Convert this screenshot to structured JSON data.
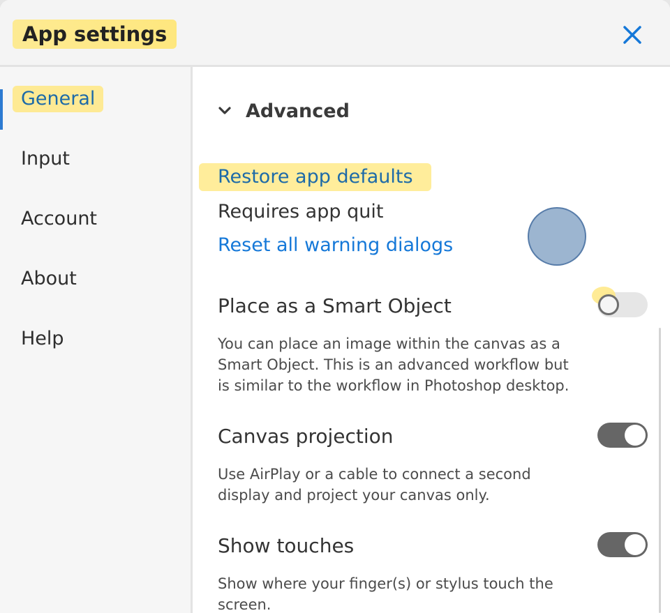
{
  "header": {
    "title": "App settings"
  },
  "sidebar": {
    "items": [
      {
        "label": "General"
      },
      {
        "label": "Input"
      },
      {
        "label": "Account"
      },
      {
        "label": "About"
      },
      {
        "label": "Help"
      }
    ]
  },
  "main": {
    "section_title": "Advanced",
    "restore_link": "Restore app defaults",
    "restore_note": "Requires app quit",
    "reset_link": "Reset all warning dialogs",
    "settings": [
      {
        "title": "Place as a Smart Object",
        "description": "You can place an image within the canvas as a Smart Object. This is an advanced workflow but is similar to the workflow in Photoshop desktop.",
        "enabled": false
      },
      {
        "title": "Canvas projection",
        "description": "Use AirPlay or a cable to connect a second display and project your canvas only.",
        "enabled": true
      },
      {
        "title": "Show touches",
        "description": "Show where your finger(s) or stylus touch the screen.",
        "enabled": true
      }
    ]
  },
  "colors": {
    "accent_blue": "#1578d8",
    "link_blue": "#1d6aa8",
    "highlight_yellow": "#ffe882",
    "toggle_on": "#666666",
    "toggle_off": "#e6e6e6"
  },
  "icons": {
    "close": "close-icon",
    "section": "chevron-down-icon"
  }
}
